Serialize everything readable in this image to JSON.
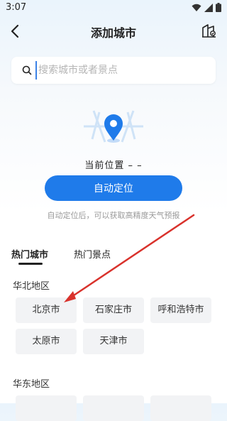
{
  "status_bar": {
    "time": "3:07"
  },
  "header": {
    "title": "添加城市"
  },
  "search": {
    "placeholder": "搜索城市或者景点"
  },
  "location": {
    "current_label": "当前位置 – –",
    "auto_button": "自动定位",
    "hint": "自动定位后，可以获取高精度天气预报"
  },
  "tabs": [
    {
      "label": "热门城市",
      "active": true
    },
    {
      "label": "热门景点",
      "active": false
    }
  ],
  "regions": [
    {
      "title": "华北地区",
      "cities": [
        "北京市",
        "石家庄市",
        "呼和浩特市",
        "太原市",
        "天津市"
      ]
    },
    {
      "title": "华东地区"
    }
  ],
  "colors": {
    "accent": "#1f7bea",
    "annotation_arrow": "#d9322c"
  }
}
